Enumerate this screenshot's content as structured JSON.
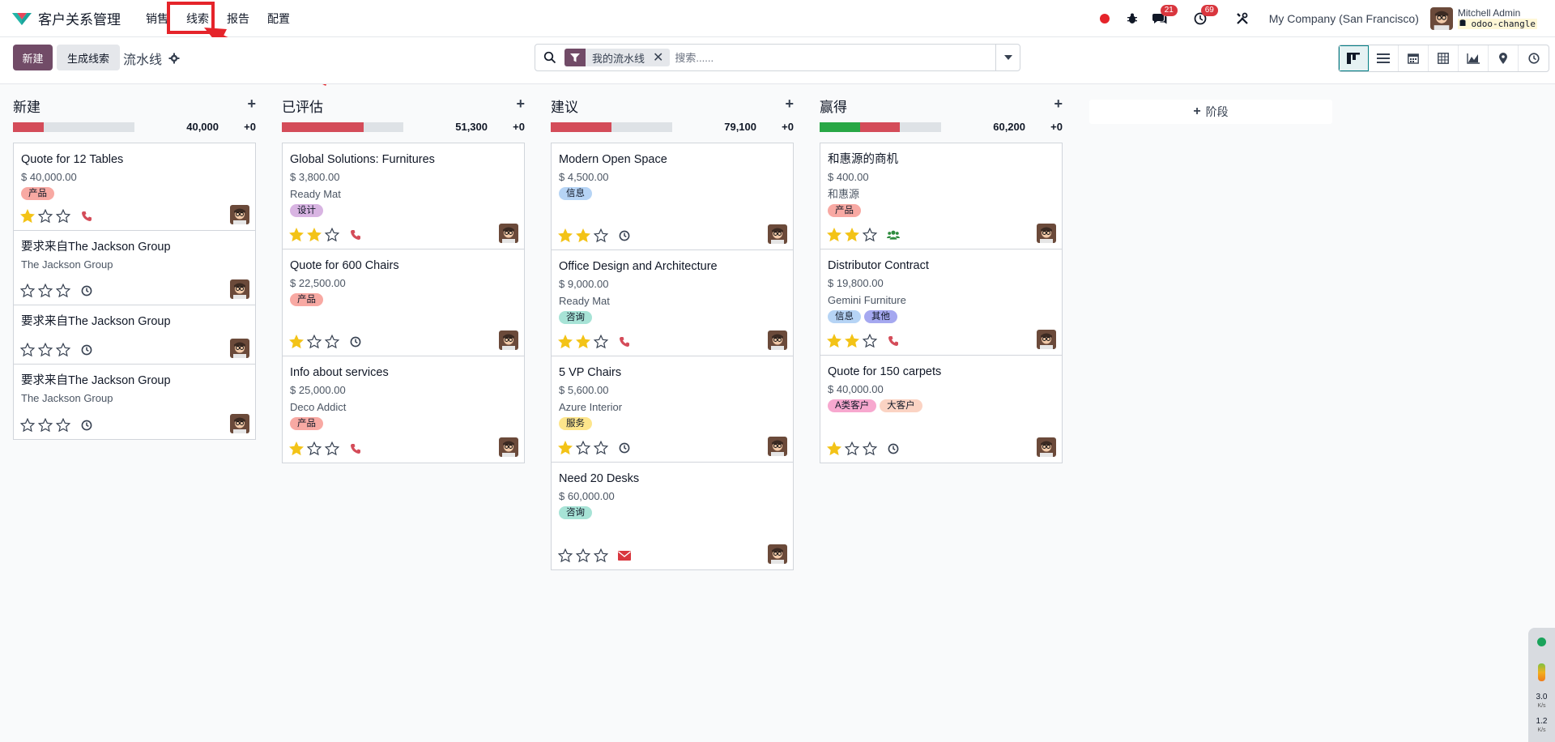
{
  "app": {
    "name": "客户关系管理"
  },
  "menu": [
    "销售",
    "线索",
    "报告",
    "配置"
  ],
  "systray": {
    "chat_count": "21",
    "activity_count": "69",
    "company": "My Company (San Francisco)",
    "user_name": "Mitchell Admin",
    "db_name": "odoo-changle"
  },
  "control": {
    "new_label": "新建",
    "generate_label": "生成线索",
    "breadcrumb": "流水线",
    "filter_facet": "我的流水线",
    "search_placeholder": "搜索......"
  },
  "views": [
    "kanban-icon",
    "list-icon",
    "calendar-icon",
    "pivot-icon",
    "graph-icon",
    "map-pin-icon",
    "activity-icon"
  ],
  "colors": {
    "brand": "#714b67",
    "danger": "#d44c59",
    "success": "#28a745",
    "muted": "#dee2e6",
    "accent": "#017e84"
  },
  "kanban": {
    "columns": [
      {
        "title": "新建",
        "total": "40,000",
        "plus": "+0",
        "progress": [
          {
            "color": "#d44c59",
            "percent": 25
          }
        ],
        "cards": [
          {
            "title": "Quote for 12 Tables",
            "amount": "$ 40,000.00",
            "company": "",
            "tags": [
              {
                "label": "产品",
                "bg": "#f8a9a3"
              }
            ],
            "stars": 1,
            "activity": "phone"
          },
          {
            "title": "要求来自The Jackson Group",
            "amount": "",
            "company": "The Jackson Group",
            "tags": [],
            "stars": 0,
            "activity": "clock"
          },
          {
            "title": "要求来自The Jackson Group",
            "amount": "",
            "company": "",
            "tags": [],
            "stars": 0,
            "activity": "clock"
          },
          {
            "title": "要求来自The Jackson Group",
            "amount": "",
            "company": "The Jackson Group",
            "tags": [],
            "stars": 0,
            "activity": "clock"
          }
        ]
      },
      {
        "title": "已评估",
        "total": "51,300",
        "plus": "+0",
        "progress": [
          {
            "color": "#d44c59",
            "percent": 67
          }
        ],
        "cards": [
          {
            "title": "Global Solutions: Furnitures",
            "amount": "$ 3,800.00",
            "company": "Ready Mat",
            "tags": [
              {
                "label": "设计",
                "bg": "#d8b4e2"
              }
            ],
            "stars": 2,
            "activity": "phone"
          },
          {
            "title": "Quote for 600 Chairs",
            "amount": "$ 22,500.00",
            "company": "",
            "tags": [
              {
                "label": "产品",
                "bg": "#f8a9a3"
              }
            ],
            "stars": 1,
            "activity": "clock"
          },
          {
            "title": "Info about services",
            "amount": "$ 25,000.00",
            "company": "Deco Addict",
            "tags": [
              {
                "label": "产品",
                "bg": "#f8a9a3"
              }
            ],
            "stars": 1,
            "activity": "phone"
          }
        ]
      },
      {
        "title": "建议",
        "total": "79,100",
        "plus": "+0",
        "progress": [
          {
            "color": "#d44c59",
            "percent": 50
          }
        ],
        "cards": [
          {
            "title": "Modern Open Space",
            "amount": "$ 4,500.00",
            "company": "",
            "tags": [
              {
                "label": "信息",
                "bg": "#b6d4f5"
              }
            ],
            "stars": 2,
            "activity": "clock"
          },
          {
            "title": "Office Design and Architecture",
            "amount": "$ 9,000.00",
            "company": "Ready Mat",
            "tags": [
              {
                "label": "咨询",
                "bg": "#a7e3d6"
              }
            ],
            "stars": 2,
            "activity": "phone"
          },
          {
            "title": "5 VP Chairs",
            "amount": "$ 5,600.00",
            "company": "Azure Interior",
            "tags": [
              {
                "label": "服务",
                "bg": "#fde58b"
              }
            ],
            "stars": 1,
            "activity": "clock"
          },
          {
            "title": "Need 20 Desks",
            "amount": "$ 60,000.00",
            "company": "",
            "tags": [
              {
                "label": "咨询",
                "bg": "#a7e3d6"
              }
            ],
            "stars": 0,
            "activity": "mail"
          }
        ]
      },
      {
        "title": "赢得",
        "total": "60,200",
        "plus": "+0",
        "progress": [
          {
            "color": "#28a745",
            "percent": 33
          },
          {
            "color": "#d44c59",
            "percent": 33
          }
        ],
        "cards": [
          {
            "title": "和惠源的商机",
            "amount": "$ 400.00",
            "company": "和惠源",
            "tags": [
              {
                "label": "产品",
                "bg": "#f8a9a3"
              }
            ],
            "stars": 2,
            "activity": "users"
          },
          {
            "title": "Distributor Contract",
            "amount": "$ 19,800.00",
            "company": "Gemini Furniture",
            "tags": [
              {
                "label": "信息",
                "bg": "#b6d4f5"
              },
              {
                "label": "其他",
                "bg": "#a5a8f0"
              }
            ],
            "stars": 2,
            "activity": "phone"
          },
          {
            "title": "Quote for 150 carpets",
            "amount": "$ 40,000.00",
            "company": "",
            "tags": [
              {
                "label": "A类客户",
                "bg": "#f7a8cf"
              },
              {
                "label": "大客户",
                "bg": "#fbd3c3"
              }
            ],
            "stars": 1,
            "activity": "clock"
          }
        ]
      }
    ],
    "add_stage_label": "阶段"
  },
  "net_widget": {
    "down": "3.0",
    "down_unit": "K/s",
    "up": "1.2",
    "up_unit": "K/s"
  }
}
